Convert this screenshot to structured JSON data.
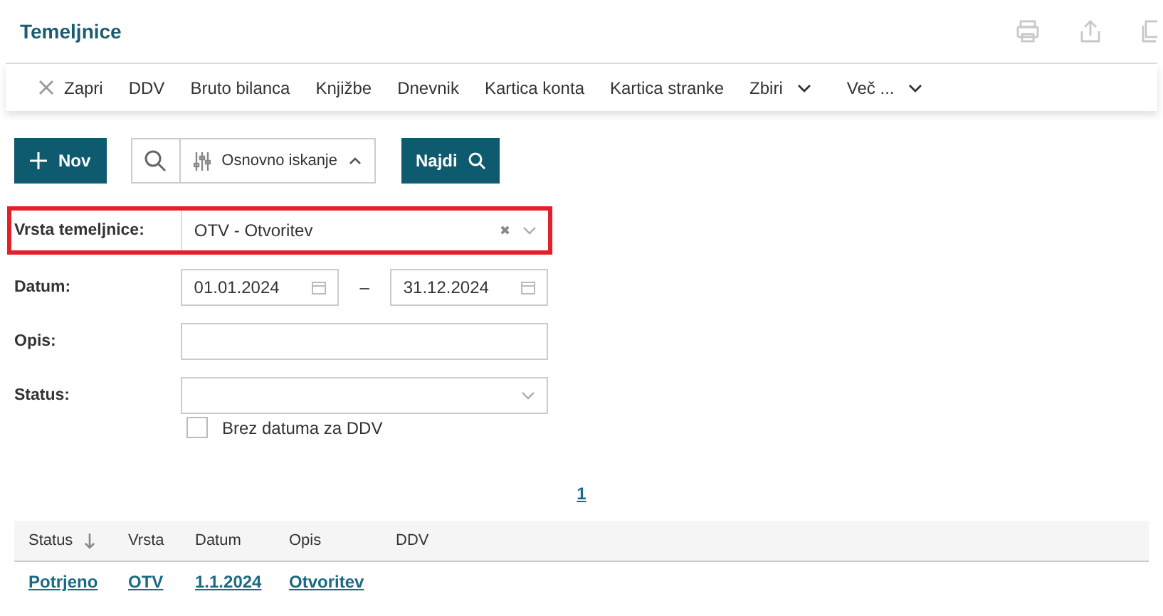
{
  "title": "Temeljnice",
  "toolbar": [
    {
      "label": "Zapri",
      "kind": "close"
    },
    {
      "label": "DDV",
      "kind": "plain"
    },
    {
      "label": "Bruto bilanca",
      "kind": "plain"
    },
    {
      "label": "Knjižbe",
      "kind": "plain"
    },
    {
      "label": "Dnevnik",
      "kind": "plain"
    },
    {
      "label": "Kartica konta",
      "kind": "plain"
    },
    {
      "label": "Kartica stranke",
      "kind": "plain"
    },
    {
      "label": "Zbiri",
      "kind": "dropdown"
    },
    {
      "label": "Več ...",
      "kind": "dropdown"
    }
  ],
  "new_button": "Nov",
  "search_mode": "Osnovno iskanje",
  "find_button": "Najdi",
  "form": [
    {
      "label": "Vrsta temeljnice:",
      "kind": "select",
      "value": "OTV - Otvoritev",
      "clear": "✖",
      "highlighted": true
    },
    {
      "label": "Datum:",
      "kind": "daterange",
      "from": "01.01.2024",
      "separator": "–",
      "to": "31.12.2024",
      "highlighted": false
    },
    {
      "label": "Opis:",
      "kind": "text",
      "highlighted": false
    },
    {
      "label": "Status:",
      "kind": "select",
      "highlighted": false
    }
  ],
  "checkbox": {
    "label": "Brez datuma za DDV",
    "checked": false
  },
  "pager": "1",
  "table": {
    "columns": [
      "Status",
      "Vrsta",
      "Datum",
      "Opis",
      "DDV"
    ],
    "rows": [
      [
        "Potrjeno",
        "OTV",
        "1.1.2024",
        "Otvoritev",
        ""
      ]
    ]
  }
}
